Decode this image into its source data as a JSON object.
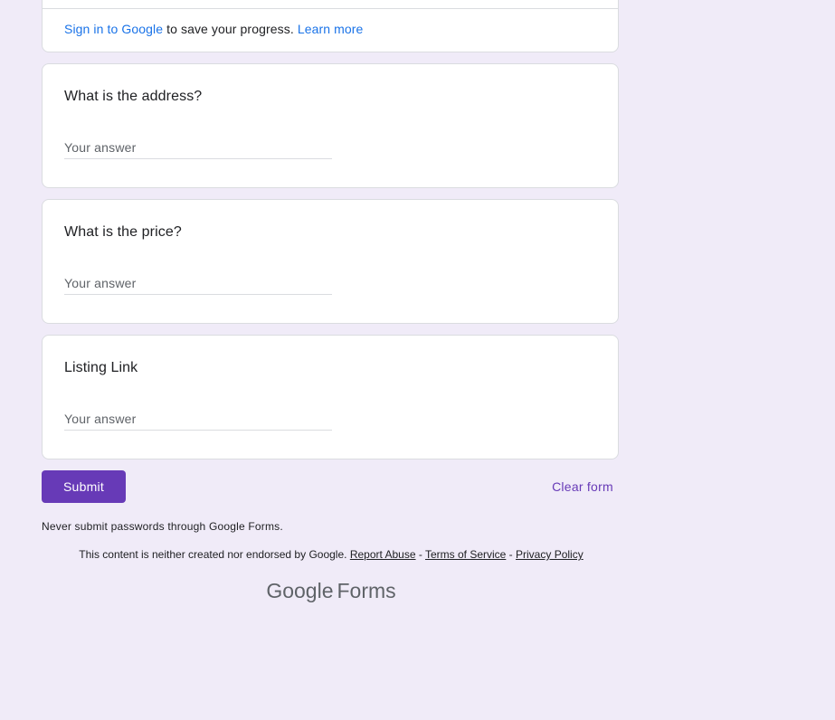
{
  "signin": {
    "link_label": "Sign in to Google",
    "text": " to save your progress. ",
    "learn_more": "Learn more"
  },
  "questions": [
    {
      "title": "What is the address?",
      "placeholder": "Your answer"
    },
    {
      "title": "What is the price?",
      "placeholder": "Your answer"
    },
    {
      "title": "Listing Link",
      "placeholder": "Your answer"
    }
  ],
  "actions": {
    "submit_label": "Submit",
    "clear_label": "Clear form"
  },
  "footer": {
    "never_submit": "Never submit passwords through Google Forms.",
    "disclaimer": "This content is neither created nor endorsed by Google. ",
    "report_abuse": "Report Abuse",
    "sep1": " - ",
    "terms": "Terms of Service",
    "sep2": " - ",
    "privacy": "Privacy Policy",
    "logo_google": "Google",
    "logo_forms": "Forms"
  },
  "colors": {
    "background": "#f0ebf8",
    "accent": "#673ab7",
    "link": "#1a73e8"
  }
}
